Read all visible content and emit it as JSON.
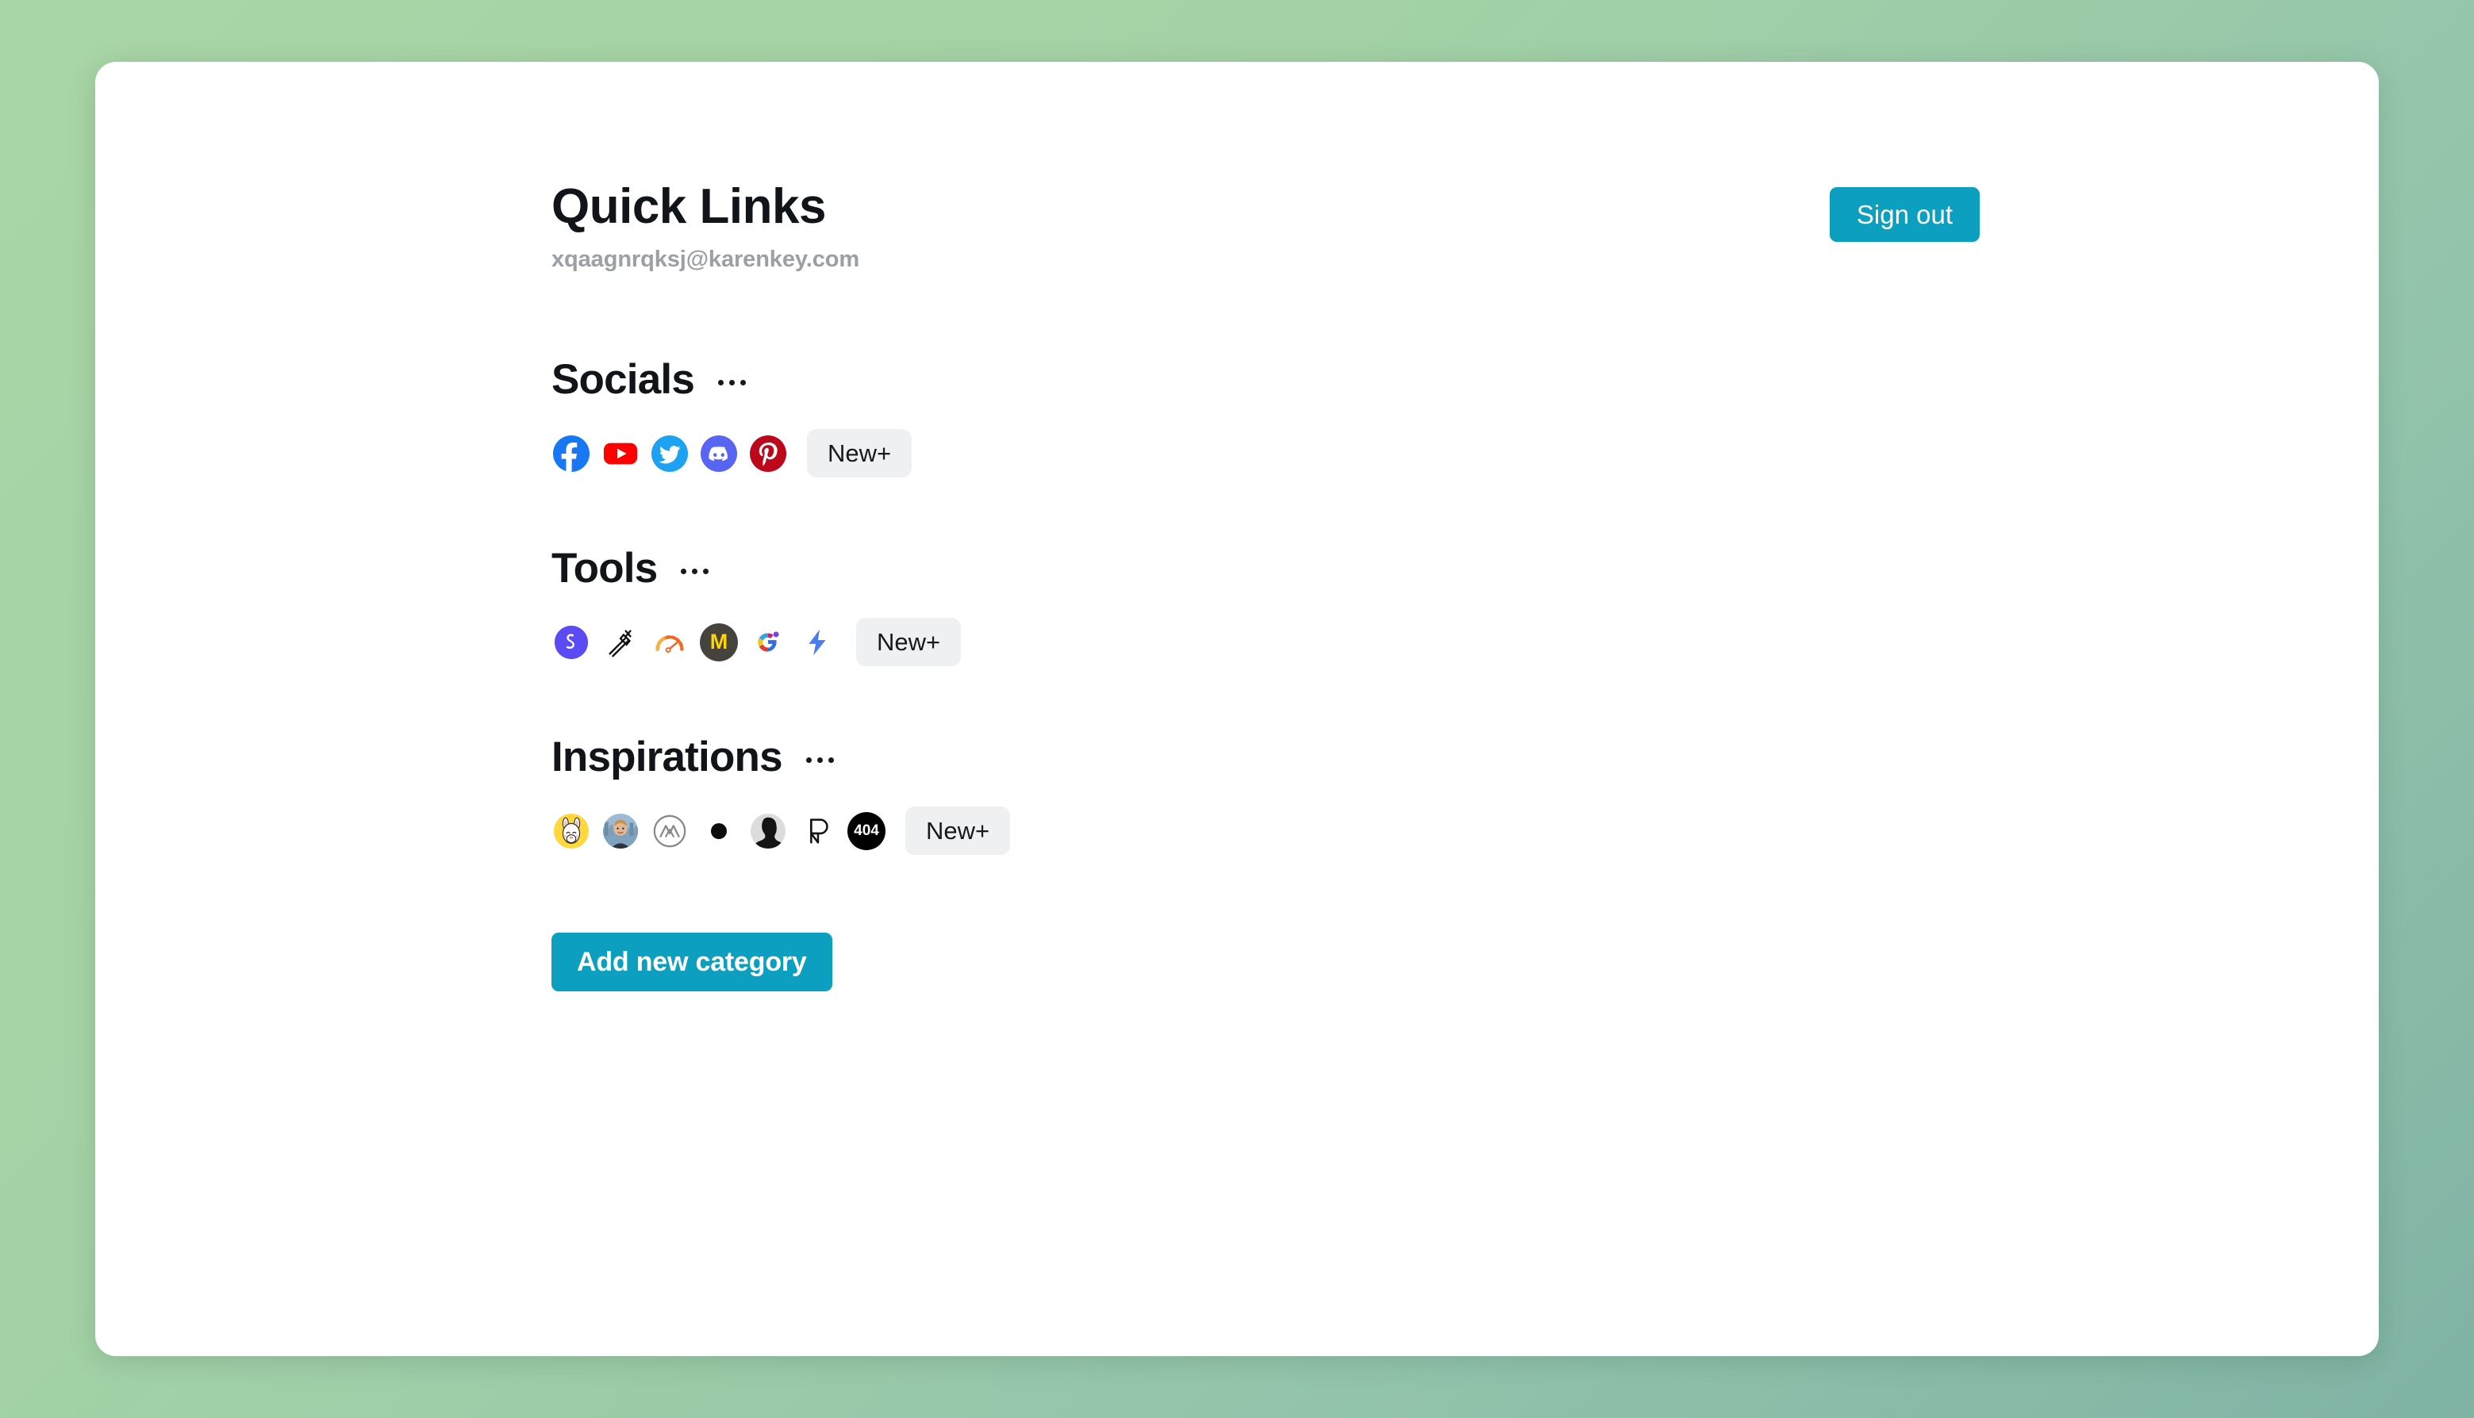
{
  "background": {
    "gradient_from": "#a9d6a6",
    "gradient_to": "#7fb3a4"
  },
  "header": {
    "title": "Quick Links",
    "email": "xqaagnrqksj@karenkey.com",
    "signout_label": "Sign out"
  },
  "theme": {
    "accent": "#0d9fbf",
    "chip_bg": "#eff0f2",
    "text": "#111418",
    "muted": "#9aa0a6"
  },
  "categories": [
    {
      "name": "Socials",
      "menu_label": "...",
      "new_label": "New+",
      "links": [
        {
          "icon": "facebook-icon",
          "color": "#1877f2"
        },
        {
          "icon": "youtube-icon",
          "color": "#ff0000"
        },
        {
          "icon": "twitter-icon",
          "color": "#1da1f2"
        },
        {
          "icon": "discord-icon",
          "color": "#5865f2"
        },
        {
          "icon": "pinterest-icon",
          "color": "#bd081c"
        }
      ]
    },
    {
      "name": "Tools",
      "menu_label": "...",
      "new_label": "New+",
      "links": [
        {
          "icon": "squarespace-s-icon",
          "color": "#5b4bf5"
        },
        {
          "icon": "pen-tool-icon",
          "color": "#0d0d0d"
        },
        {
          "icon": "speed-gauge-icon",
          "color": "#f26722"
        },
        {
          "icon": "monogram-m-icon",
          "color": "#46433f"
        },
        {
          "icon": "gemini-g-icon",
          "color": "#ef4b3c"
        },
        {
          "icon": "lightning-bolt-icon",
          "color": "#4a7cf0"
        }
      ]
    },
    {
      "name": "Inspirations",
      "menu_label": "...",
      "new_label": "New+",
      "links": [
        {
          "icon": "llama-avatar-icon",
          "color": "#ffd83d"
        },
        {
          "icon": "person-photo-avatar-icon",
          "color": "#8fa7bd"
        },
        {
          "icon": "circle-monogram-icon",
          "color": "#7a7a7a"
        },
        {
          "icon": "black-dot-icon",
          "color": "#0d0d0d"
        },
        {
          "icon": "silhouette-avatar-icon",
          "color": "#1a1a1a"
        },
        {
          "icon": "p-outline-icon",
          "color": "#111111"
        },
        {
          "icon": "404-badge-icon",
          "color": "#000000",
          "text": "404"
        }
      ]
    }
  ],
  "footer": {
    "add_category_label": "Add new category"
  }
}
